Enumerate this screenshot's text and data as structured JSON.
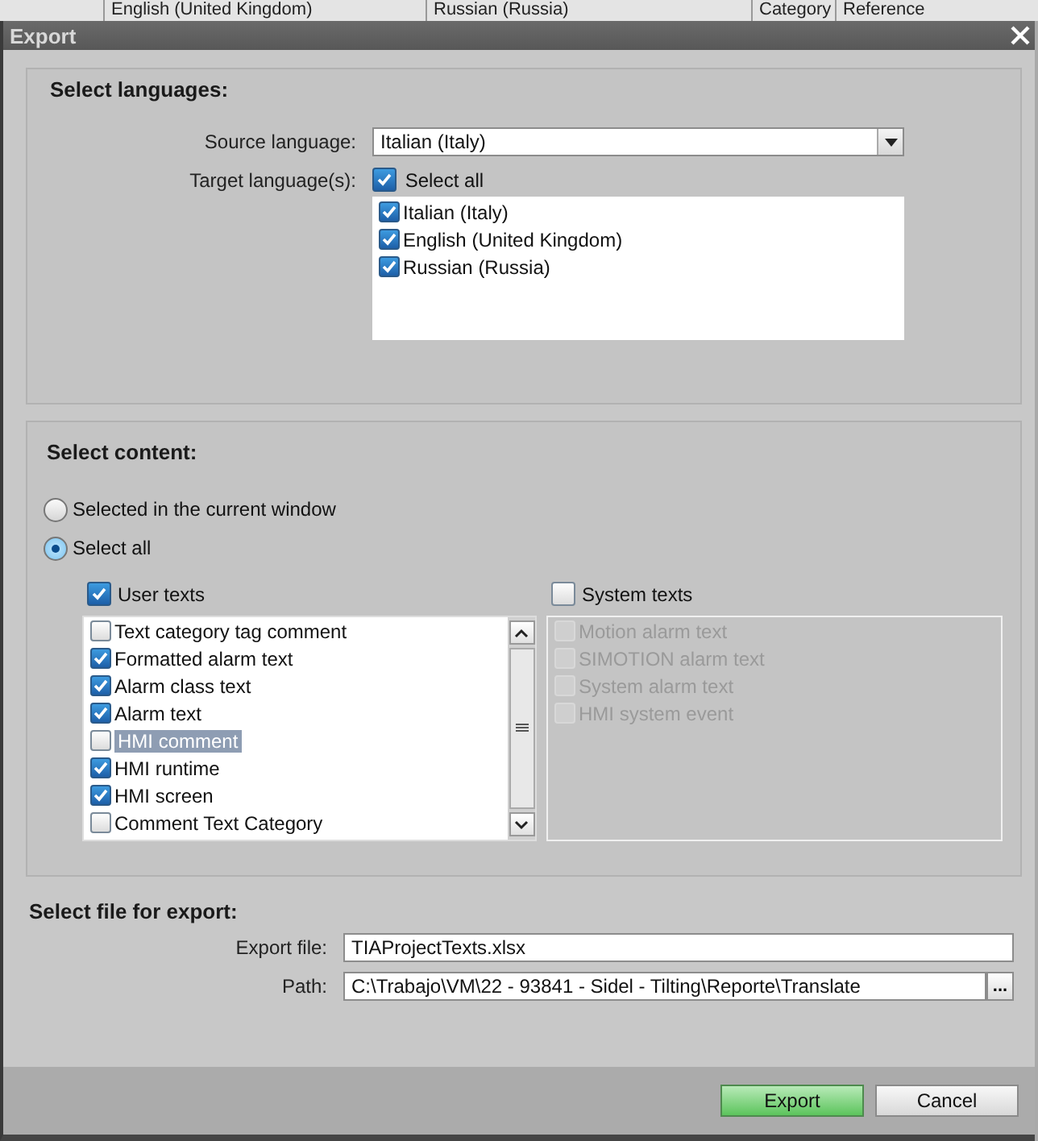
{
  "background_table": {
    "columns": [
      "English (United Kingdom)",
      "Russian (Russia)",
      "Category",
      "Reference"
    ]
  },
  "window": {
    "title": "Export"
  },
  "languages": {
    "heading": "Select languages:",
    "source_label": "Source language:",
    "source_value": "Italian (Italy)",
    "target_label": "Target language(s):",
    "select_all": {
      "label": "Select all",
      "checked": true
    },
    "items": [
      {
        "label": "Italian (Italy)",
        "checked": true
      },
      {
        "label": "English (United Kingdom)",
        "checked": true
      },
      {
        "label": "Russian (Russia)",
        "checked": true
      }
    ]
  },
  "content": {
    "heading": "Select content:",
    "options": [
      {
        "label": "Selected in the current window",
        "selected": false
      },
      {
        "label": "Select all",
        "selected": true
      }
    ],
    "user_texts": {
      "label": "User texts",
      "checked": true,
      "items": [
        {
          "label": "Text category tag comment",
          "checked": false,
          "selected": false
        },
        {
          "label": "Formatted alarm text",
          "checked": true,
          "selected": false
        },
        {
          "label": "Alarm class text",
          "checked": true,
          "selected": false
        },
        {
          "label": "Alarm text",
          "checked": true,
          "selected": false
        },
        {
          "label": "HMI comment",
          "checked": false,
          "selected": true
        },
        {
          "label": "HMI runtime",
          "checked": true,
          "selected": false
        },
        {
          "label": "HMI screen",
          "checked": true,
          "selected": false
        },
        {
          "label": "Comment Text Category",
          "checked": false,
          "selected": false
        }
      ]
    },
    "system_texts": {
      "label": "System texts",
      "checked": false,
      "items": [
        {
          "label": "Motion alarm text",
          "checked": false,
          "disabled": true
        },
        {
          "label": "SIMOTION alarm text",
          "checked": false,
          "disabled": true
        },
        {
          "label": "System alarm text",
          "checked": false,
          "disabled": true
        },
        {
          "label": "HMI system event",
          "checked": false,
          "disabled": true
        }
      ]
    }
  },
  "file": {
    "heading": "Select file for export:",
    "export_file_label": "Export file:",
    "export_file_value": "TIAProjectTexts.xlsx",
    "path_label": "Path:",
    "path_value": "C:\\Trabajo\\VM\\22 - 93841 - Sidel - Tilting\\Reporte\\Translate",
    "browse": "..."
  },
  "buttons": [
    {
      "label": "Export",
      "kind": "primary"
    },
    {
      "label": "Cancel",
      "kind": "normal"
    }
  ]
}
